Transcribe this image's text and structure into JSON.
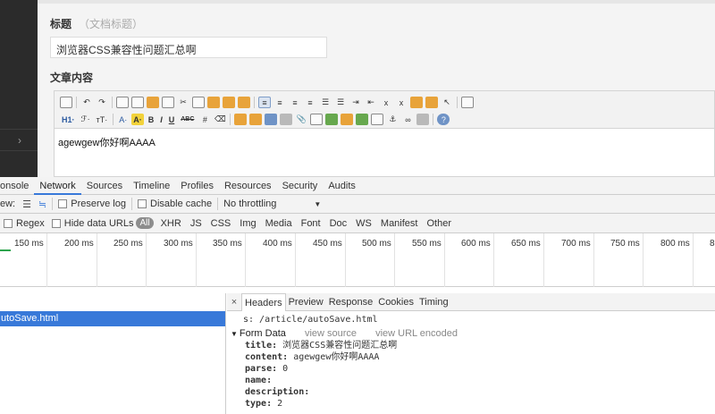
{
  "editor": {
    "title_label": "标题",
    "title_hint": "（文档标题）",
    "title_value": "浏览器CSS兼容性问题汇总啊",
    "content_label": "文章内容",
    "content_value": "agewgew你好啊AAAA",
    "toolbar_row2_labels": [
      "H1·",
      "ℱ·",
      "тT·",
      "A·",
      "A·",
      "B",
      "I",
      "U",
      "ABC"
    ]
  },
  "left_panel": {
    "nav_arrow": "›"
  },
  "devtools": {
    "tabs": [
      "onsole",
      "Network",
      "Sources",
      "Timeline",
      "Profiles",
      "Resources",
      "Security",
      "Audits"
    ],
    "active_tab": "Network",
    "bar2": {
      "view_label": "ew:",
      "preserve_log": "Preserve log",
      "disable_cache": "Disable cache",
      "throttle": "No throttling",
      "throttle_arrow": "▼"
    },
    "bar3": {
      "regex": "Regex",
      "hide_data_urls": "Hide data URLs",
      "all": "All",
      "filters": [
        "XHR",
        "JS",
        "CSS",
        "Img",
        "Media",
        "Font",
        "Doc",
        "WS",
        "Manifest",
        "Other"
      ]
    },
    "timeline_ticks": [
      "150 ms",
      "200 ms",
      "250 ms",
      "300 ms",
      "350 ms",
      "400 ms",
      "450 ms",
      "500 ms",
      "550 ms",
      "600 ms",
      "650 ms",
      "700 ms",
      "750 ms",
      "800 ms",
      "8"
    ],
    "request_name": "utoSave.html",
    "detail": {
      "close": "×",
      "tabs": [
        "Headers",
        "Preview",
        "Response",
        "Cookies",
        "Timing"
      ],
      "active_tab": "Headers",
      "url_line": "s: /article/autoSave.html",
      "form_data_label": "Form Data",
      "view_source": "view source",
      "view_url_encoded": "view URL encoded",
      "form_fields": [
        {
          "key": "title:",
          "value": "浏览器CSS兼容性问题汇总啊"
        },
        {
          "key": "content:",
          "value": "agewgew你好啊AAAA"
        },
        {
          "key": "parse:",
          "value": "0"
        },
        {
          "key": "name:",
          "value": ""
        },
        {
          "key": "description:",
          "value": ""
        },
        {
          "key": "type:",
          "value": "2"
        }
      ]
    }
  },
  "colors": {
    "accent": "#3879d9",
    "sidebar": "#2b2b2b"
  }
}
